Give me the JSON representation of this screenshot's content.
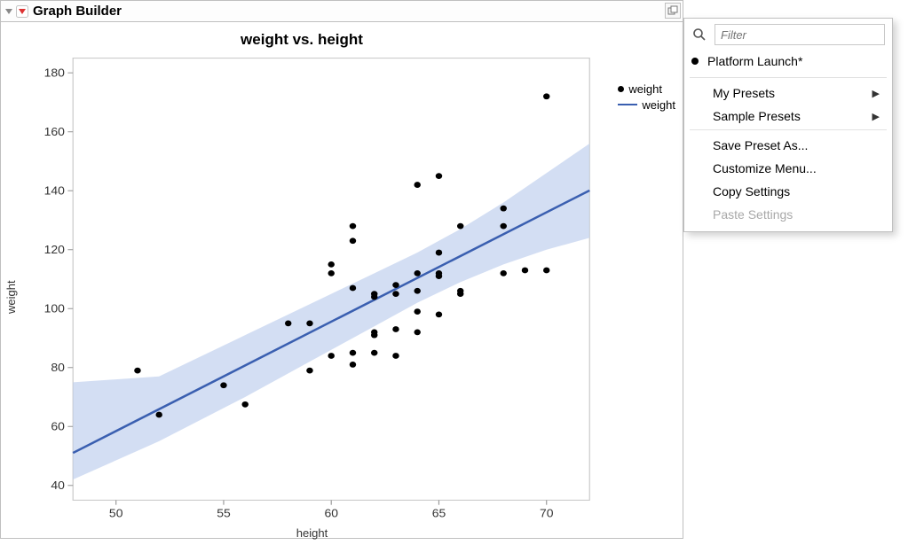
{
  "header": {
    "title": "Graph Builder"
  },
  "chart_data": {
    "type": "scatter",
    "title": "weight vs. height",
    "xlabel": "height",
    "ylabel": "weight",
    "xlim": [
      48,
      72
    ],
    "ylim": [
      35,
      185
    ],
    "xticks": [
      50,
      55,
      60,
      65,
      70
    ],
    "yticks": [
      40,
      60,
      80,
      100,
      120,
      140,
      160,
      180
    ],
    "points": [
      {
        "x": 51,
        "y": 79
      },
      {
        "x": 52,
        "y": 64
      },
      {
        "x": 55,
        "y": 74
      },
      {
        "x": 56,
        "y": 67.5
      },
      {
        "x": 58,
        "y": 95
      },
      {
        "x": 59,
        "y": 79
      },
      {
        "x": 59,
        "y": 95
      },
      {
        "x": 60,
        "y": 84
      },
      {
        "x": 60,
        "y": 112
      },
      {
        "x": 60,
        "y": 115
      },
      {
        "x": 61,
        "y": 81
      },
      {
        "x": 61,
        "y": 85
      },
      {
        "x": 61,
        "y": 107
      },
      {
        "x": 61,
        "y": 123
      },
      {
        "x": 61,
        "y": 128
      },
      {
        "x": 62,
        "y": 91
      },
      {
        "x": 62,
        "y": 92
      },
      {
        "x": 62,
        "y": 104
      },
      {
        "x": 62,
        "y": 85
      },
      {
        "x": 62,
        "y": 105
      },
      {
        "x": 63,
        "y": 84
      },
      {
        "x": 63,
        "y": 93
      },
      {
        "x": 63,
        "y": 105
      },
      {
        "x": 63,
        "y": 108
      },
      {
        "x": 64,
        "y": 92
      },
      {
        "x": 64,
        "y": 99
      },
      {
        "x": 64,
        "y": 106
      },
      {
        "x": 64,
        "y": 112
      },
      {
        "x": 64,
        "y": 142
      },
      {
        "x": 65,
        "y": 98
      },
      {
        "x": 65,
        "y": 111
      },
      {
        "x": 65,
        "y": 112
      },
      {
        "x": 65,
        "y": 119
      },
      {
        "x": 65,
        "y": 145
      },
      {
        "x": 66,
        "y": 105
      },
      {
        "x": 66,
        "y": 106
      },
      {
        "x": 66,
        "y": 128
      },
      {
        "x": 68,
        "y": 112
      },
      {
        "x": 68,
        "y": 128
      },
      {
        "x": 68,
        "y": 134
      },
      {
        "x": 69,
        "y": 113
      },
      {
        "x": 70,
        "y": 172
      },
      {
        "x": 70,
        "y": 113
      }
    ],
    "fit": {
      "slope": 3.711,
      "intercept": -127.1
    },
    "band": [
      {
        "x": 48,
        "lo": 42,
        "hi": 75
      },
      {
        "x": 52,
        "lo": 55,
        "hi": 77
      },
      {
        "x": 56,
        "lo": 70,
        "hi": 91
      },
      {
        "x": 60,
        "lo": 86,
        "hi": 105
      },
      {
        "x": 62,
        "lo": 94,
        "hi": 112
      },
      {
        "x": 64,
        "lo": 102,
        "hi": 119
      },
      {
        "x": 66,
        "lo": 109,
        "hi": 127
      },
      {
        "x": 68,
        "lo": 115,
        "hi": 136
      },
      {
        "x": 70,
        "lo": 120,
        "hi": 146
      },
      {
        "x": 72,
        "lo": 124,
        "hi": 156
      }
    ],
    "legend": [
      {
        "type": "dot",
        "label": "weight"
      },
      {
        "type": "line",
        "label": "weight"
      }
    ]
  },
  "menu": {
    "filter_placeholder": "Filter",
    "lead": "Platform Launch*",
    "items": [
      {
        "label": "My Presets",
        "submenu": true,
        "enabled": true
      },
      {
        "label": "Sample Presets",
        "submenu": true,
        "enabled": true
      }
    ],
    "items2": [
      {
        "label": "Save Preset As...",
        "submenu": false,
        "enabled": true
      },
      {
        "label": "Customize Menu...",
        "submenu": false,
        "enabled": true
      },
      {
        "label": "Copy Settings",
        "submenu": false,
        "enabled": true
      },
      {
        "label": "Paste Settings",
        "submenu": false,
        "enabled": false
      }
    ]
  }
}
